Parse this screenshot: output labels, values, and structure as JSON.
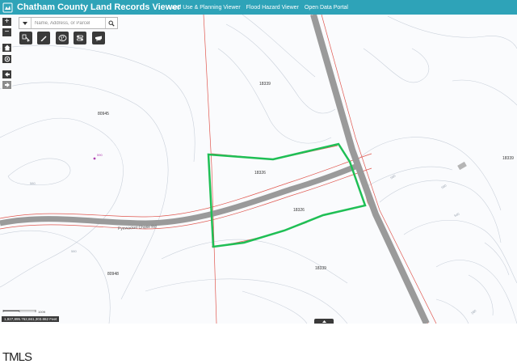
{
  "header": {
    "title": "Chatham County Land Records Viewer",
    "nav": [
      {
        "label": "Land Use & Planning Viewer"
      },
      {
        "label": "Flood Hazard Viewer"
      },
      {
        "label": "Open Data Portal"
      }
    ]
  },
  "search": {
    "placeholder": "Name, Address, or Parcel"
  },
  "controls": {
    "zoom_in": "+",
    "zoom_out": "−"
  },
  "tools": [
    {
      "icon": "identify-icon"
    },
    {
      "icon": "draw-icon"
    },
    {
      "icon": "layers-icon"
    },
    {
      "icon": "toggle-icon"
    },
    {
      "icon": "print-icon"
    }
  ],
  "map": {
    "parcels": [
      {
        "id": "18339"
      },
      {
        "id": "80945"
      },
      {
        "id": "18326"
      },
      {
        "id": "18326"
      },
      {
        "id": "18339"
      },
      {
        "id": "80948"
      },
      {
        "id": "18339"
      }
    ],
    "poi_label": "590",
    "road_label": "Pyewacket Chase Rd",
    "contour_labels": [
      "580",
      "580",
      "580",
      "540",
      "580",
      "580"
    ]
  },
  "scale": {
    "end_label": "100ft"
  },
  "coordinates": "1,927,895.762,661,303.862 Feet",
  "footer": {
    "logo_text": "TMLS"
  },
  "colors": {
    "header": "#2ea3b8",
    "selection": "#1fbf55",
    "parcel_line": "#e0574f",
    "road": "#9a9a9a"
  }
}
